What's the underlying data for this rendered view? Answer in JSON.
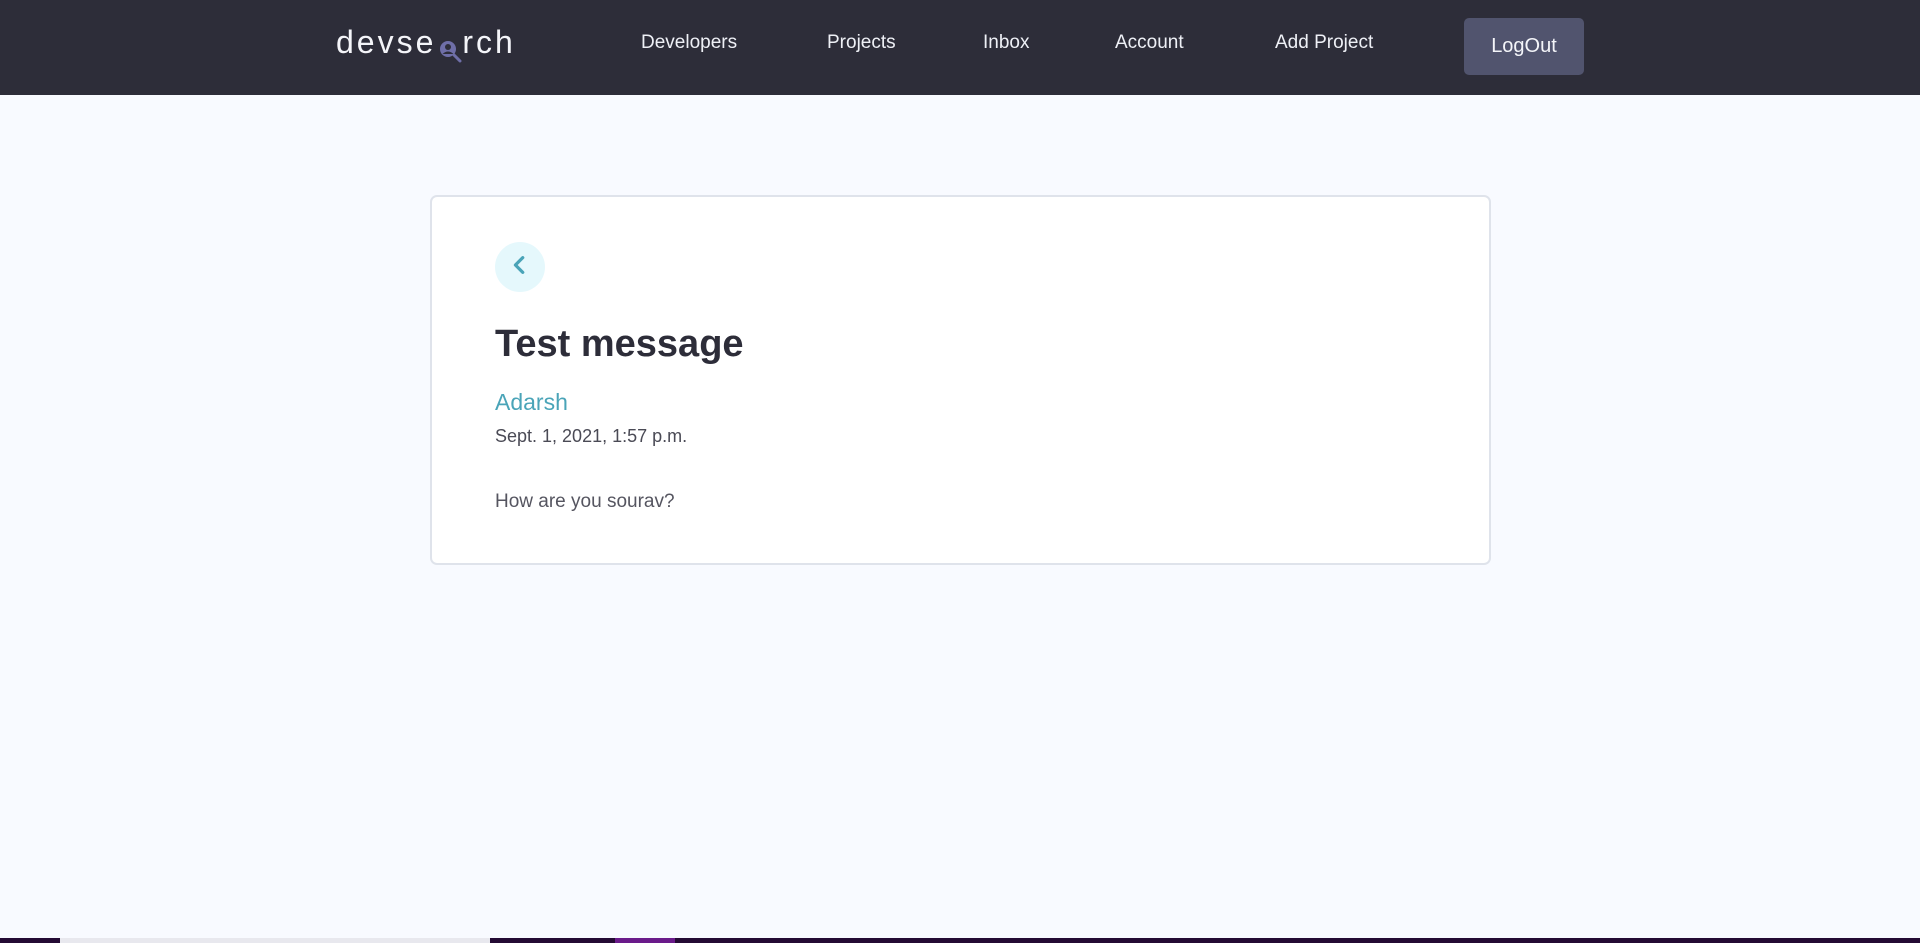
{
  "header": {
    "logo_left": "devse",
    "logo_right": "rch",
    "logo_icon": "search-person-icon",
    "nav": [
      {
        "label": "Developers"
      },
      {
        "label": "Projects"
      },
      {
        "label": "Inbox"
      },
      {
        "label": "Account"
      },
      {
        "label": "Add Project"
      }
    ],
    "logout_label": "LogOut"
  },
  "message": {
    "back_icon": "chevron-left-icon",
    "subject": "Test message",
    "sender": "Adarsh",
    "date": "Sept. 1, 2021, 1:57 p.m.",
    "body": "How are you sourav?"
  },
  "colors": {
    "header_bg": "#2d2d39",
    "page_bg": "#f8faff",
    "accent": "#4aa4b8",
    "logout_bg": "#51546e"
  }
}
